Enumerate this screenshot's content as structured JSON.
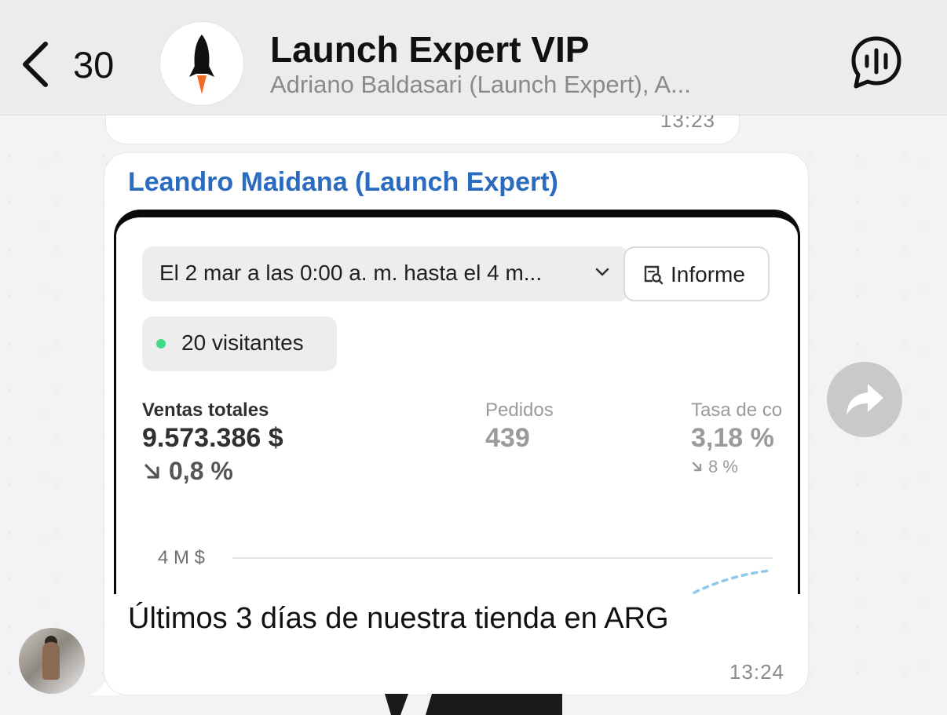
{
  "header": {
    "back_count": "30",
    "title": "Launch Expert VIP",
    "subtitle": "Adriano Baldasari (Launch Expert), A..."
  },
  "messages": {
    "previous": {
      "time": "13:23"
    },
    "current": {
      "sender": "Leandro Maidana (Launch Expert)",
      "caption": "Últimos 3 días de nuestra tienda en ARG",
      "time": "13:24"
    }
  },
  "screenshot": {
    "date_range": "El 2 mar a las 0:00 a. m. hasta el 4 m...",
    "report_label": "Informe",
    "visitors": "20 visitantes",
    "metrics": {
      "sales": {
        "label": "Ventas totales",
        "value": "9.573.386 $",
        "change": "0,8 %"
      },
      "orders": {
        "label": "Pedidos",
        "value": "439"
      },
      "conversion": {
        "label": "Tasa de co",
        "value": "3,18 %",
        "change": "8 %"
      }
    },
    "y_tick": "4 M $",
    "colors": {
      "live_dot": "#3ddc84",
      "trend_line": "#8ec9ec"
    }
  },
  "icons": {
    "back": "chevron-left-icon",
    "audio": "voice-chat-icon",
    "forward": "forward-arrow-icon",
    "rocket": "rocket-icon"
  },
  "colors": {
    "sender_name": "#2a6bbf",
    "bubble": "#ffffff",
    "header_bg": "#ececed"
  }
}
